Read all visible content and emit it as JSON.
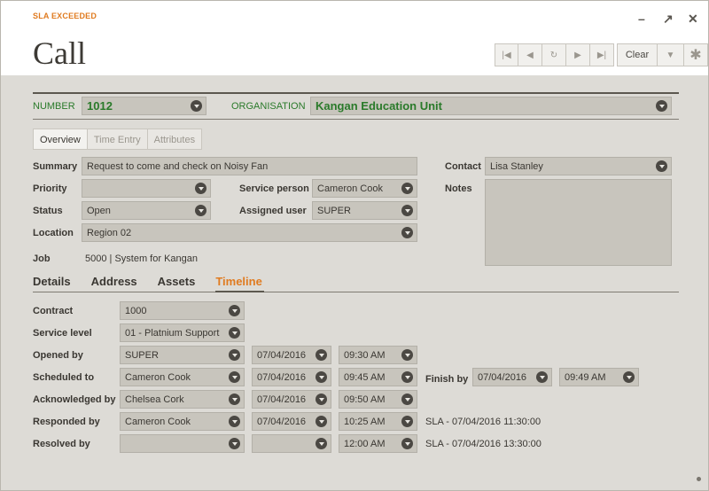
{
  "header": {
    "sla_badge": "SLA EXCEEDED",
    "title": "Call",
    "window_controls": {
      "minimize": "–",
      "maximize": "↗",
      "close": "✕"
    },
    "toolbar": {
      "first_icon": "first-record-icon",
      "prev_icon": "previous-record-icon",
      "refresh_icon": "refresh-icon",
      "next_icon": "next-record-icon",
      "last_icon": "last-record-icon",
      "clear_label": "Clear",
      "menu_icon": "chevron-down-icon",
      "pin_icon": "asterisk-icon"
    }
  },
  "top": {
    "number_label": "NUMBER",
    "number_value": "1012",
    "organisation_label": "ORGANISATION",
    "organisation_value": "Kangan Education Unit"
  },
  "tabs_small": [
    "Overview",
    "Time Entry",
    "Attributes"
  ],
  "form": {
    "summary_label": "Summary",
    "summary_value": "Request to come and check on Noisy Fan",
    "priority_label": "Priority",
    "priority_value": "",
    "service_person_label": "Service person",
    "service_person_value": "Cameron Cook",
    "status_label": "Status",
    "status_value": "Open",
    "assigned_user_label": "Assigned user",
    "assigned_user_value": "SUPER",
    "location_label": "Location",
    "location_value": "Region 02",
    "job_label": "Job",
    "job_value": "5000  |  System for Kangan",
    "contact_label": "Contact",
    "contact_value": "Lisa Stanley",
    "notes_label": "Notes"
  },
  "tabs_large": [
    "Details",
    "Address",
    "Assets",
    "Timeline"
  ],
  "timeline": {
    "contract_label": "Contract",
    "contract_value": "1000",
    "service_level_label": "Service level",
    "service_level_value": "01 - Platnium Support",
    "opened_by_label": "Opened by",
    "opened_by_value": "SUPER",
    "opened_date": "07/04/2016",
    "opened_time": "09:30 AM",
    "scheduled_to_label": "Scheduled to",
    "scheduled_to_value": "Cameron Cook",
    "scheduled_date": "07/04/2016",
    "scheduled_time": "09:45 AM",
    "finish_by_label": "Finish by",
    "finish_date": "07/04/2016",
    "finish_time": "09:49 AM",
    "acknowledged_by_label": "Acknowledged by",
    "acknowledged_by_value": "Chelsea Cork",
    "acknowledged_date": "07/04/2016",
    "acknowledged_time": "09:50 AM",
    "responded_by_label": "Responded by",
    "responded_by_value": "Cameron Cook",
    "responded_date": "07/04/2016",
    "responded_time": "10:25 AM",
    "responded_sla": "SLA - 07/04/2016 11:30:00",
    "resolved_by_label": "Resolved by",
    "resolved_by_value": "",
    "resolved_date": "",
    "resolved_time": "12:00 AM",
    "resolved_sla": "SLA - 07/04/2016 13:30:00"
  },
  "colors": {
    "accent_orange": "#e07b20",
    "label_green": "#2a7a2a",
    "field_bg": "#c8c5bd",
    "page_bg": "#dddbd6"
  }
}
